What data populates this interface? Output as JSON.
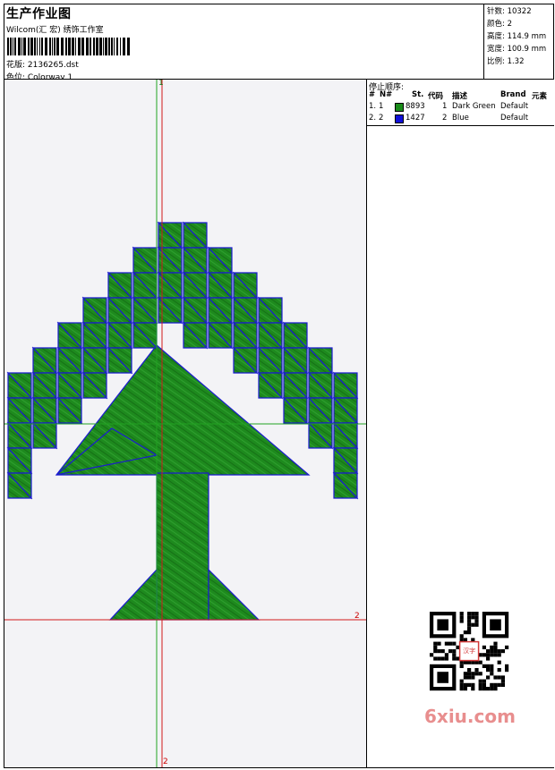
{
  "header": {
    "title": "生产作业图",
    "studio": "Wilcom(汇 宏) 绣饰工作室",
    "design_file": "花版: 2136265.dst",
    "colorway": "色位: Colorway 1"
  },
  "stats": {
    "stitches": "针数: 10322",
    "colors": "颜色: 2",
    "height": "高度: 114.9 mm",
    "width": "宽度: 100.9 mm",
    "scale": "比例: 1.32"
  },
  "stop_sequence": {
    "title": "停止顺序:",
    "columns": [
      "#",
      "N#",
      "St.",
      "代码",
      "描述",
      "Brand",
      "元素"
    ],
    "rows": [
      {
        "idx": "1.",
        "n": "1",
        "color": "#1a8c1a",
        "st": "8893",
        "code": "1",
        "desc": "Dark Green",
        "brand": "Default"
      },
      {
        "idx": "2.",
        "n": "2",
        "color": "#1010d8",
        "st": "1427",
        "code": "2",
        "desc": "Blue",
        "brand": "Default"
      }
    ]
  },
  "markers": {
    "top": "1",
    "right": "2",
    "bottom": "2"
  },
  "watermark": {
    "text": "6xiu.com",
    "stamp": "汉字\n图章"
  }
}
